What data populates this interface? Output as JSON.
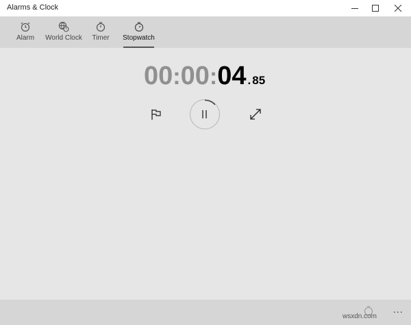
{
  "window": {
    "title": "Alarms & Clock"
  },
  "window_controls": {
    "minimize_icon": "minimize-icon",
    "maximize_icon": "maximize-icon",
    "close_icon": "close-icon"
  },
  "tabs": [
    {
      "label": "Alarm",
      "icon": "alarm-icon"
    },
    {
      "label": "World Clock",
      "icon": "world-clock-icon"
    },
    {
      "label": "Timer",
      "icon": "timer-icon"
    },
    {
      "label": "Stopwatch",
      "icon": "stopwatch-icon",
      "active": true
    }
  ],
  "stopwatch": {
    "hours": "00",
    "minutes": "00",
    "seconds": "04",
    "separator": ":",
    "decimal": ".",
    "centiseconds": "85",
    "lap_icon": "flag-icon",
    "pause_icon": "pause-icon",
    "expand_icon": "expand-icon",
    "state": "running"
  },
  "bottom_bar": {
    "more_label": "...",
    "icon": "stopwatch-icon"
  },
  "watermark": "wsxdn.com",
  "colors": {
    "background": "#e6e6e6",
    "tabbar": "#d6d6d6",
    "titlebar": "#ffffff",
    "inactive_digits": "#909090"
  }
}
